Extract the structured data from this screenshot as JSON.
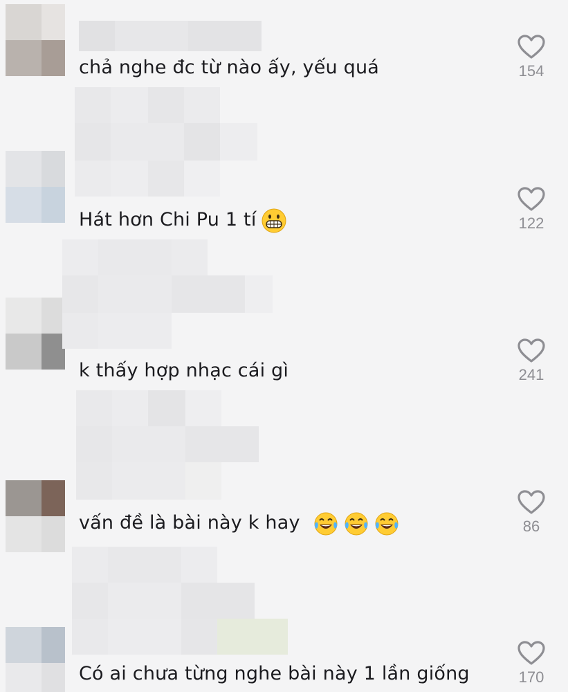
{
  "comments": [
    {
      "text": "chả nghe đc từ nào ấy, yếu quá",
      "likes": "154",
      "emojis": []
    },
    {
      "text": "Hát hơn Chi Pu 1 tí",
      "likes": "122",
      "emojis": [
        "grimacing-face"
      ]
    },
    {
      "text": "k thấy hợp nhạc cái gì",
      "likes": "241",
      "emojis": []
    },
    {
      "text": "vấn đề là bài này k hay",
      "likes": "86",
      "emojis": [
        "face-with-tears-of-joy",
        "face-with-tears-of-joy",
        "face-with-tears-of-joy"
      ]
    },
    {
      "text": "Có ai chưa từng nghe bài này 1 lần giống",
      "likes": "170",
      "emojis": []
    }
  ],
  "icons": {
    "like": "heart-outline-icon"
  },
  "colors": {
    "background": "#f4f4f5",
    "text": "#1b1b1f",
    "like_icon": "#8e8e93",
    "emoji_yellow": "#ffcc33"
  }
}
